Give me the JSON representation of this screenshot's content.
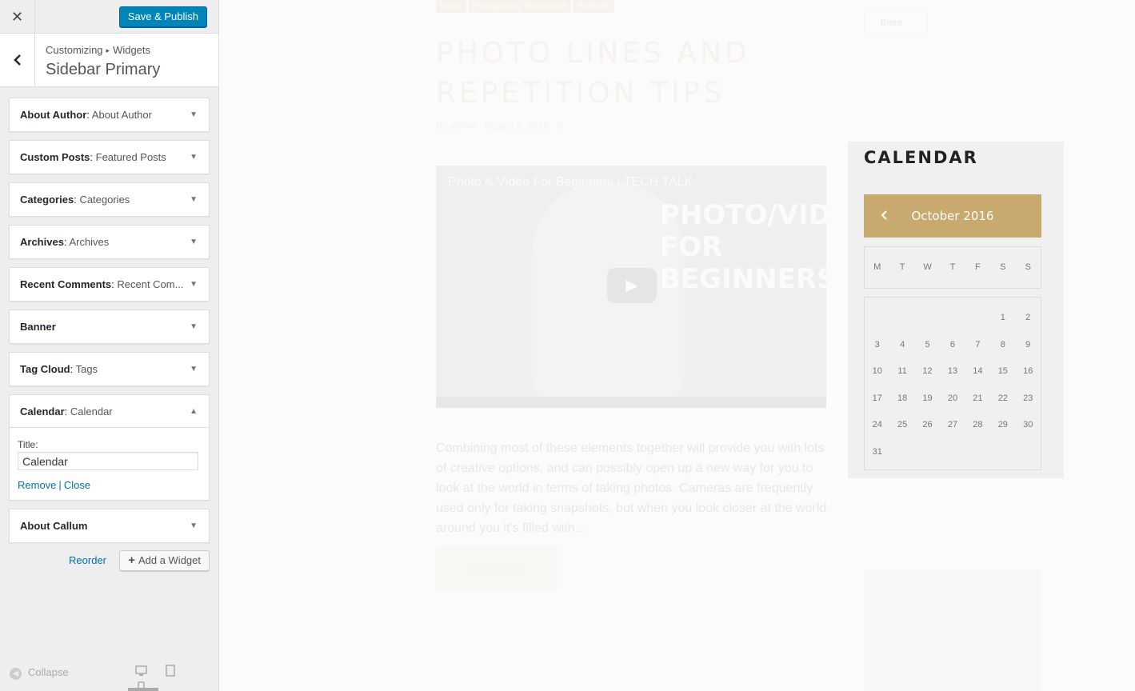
{
  "customizer": {
    "close_glyph": "✕",
    "publish_label": "Save & Publish",
    "breadcrumb_root": "Customizing",
    "breadcrumb_sep": "▸",
    "breadcrumb_leaf": "Widgets",
    "section_title": "Sidebar Primary",
    "widgets": [
      {
        "name": "About Author",
        "title": "About Author"
      },
      {
        "name": "Custom Posts",
        "title": "Featured Posts"
      },
      {
        "name": "Categories",
        "title": "Categories"
      },
      {
        "name": "Archives",
        "title": "Archives"
      },
      {
        "name": "Recent Comments",
        "title": "Recent Com..."
      },
      {
        "name": "Banner",
        "title": ""
      },
      {
        "name": "Tag Cloud",
        "title": "Tags"
      }
    ],
    "open_widget": {
      "name": "Calendar",
      "title": "Calendar",
      "field_label": "Title:",
      "field_value": "Calendar",
      "remove_label": "Remove",
      "close_label": "Close"
    },
    "last_widget": {
      "name": "About Callum",
      "title": ""
    },
    "reorder_label": "Reorder",
    "add_widget_label": "Add a Widget",
    "collapse_label": "Collapse"
  },
  "preview": {
    "tags": [
      "News",
      "Photography techniques",
      "Portraits"
    ],
    "post_title": "PHOTO LINES AND REPETITION TIPS",
    "post_meta": "By admin - August 9, 2016 - 0",
    "video_title": "Photo & Video For Beginners | TECH TALK",
    "video_overlay": "PHOTO/VIDEO FOR BEGINNERS",
    "excerpt": "Combining most of these elements together will provide you with lots of creative options, and can possibly open up a new way for you to look at the world in terms of taking photos. Cameras are frequently used only for taking snapshots, but when you look closer at the world around you it's filled with…",
    "read_more": "Read more",
    "search_text": "there",
    "calendar": {
      "heading": "CALENDAR",
      "month": "October 2016",
      "weekdays": [
        "M",
        "T",
        "W",
        "T",
        "F",
        "S",
        "S"
      ],
      "weeks": [
        [
          "",
          "",
          "",
          "",
          "",
          "1",
          "2"
        ],
        [
          "3",
          "4",
          "5",
          "6",
          "7",
          "8",
          "9"
        ],
        [
          "10",
          "11",
          "12",
          "13",
          "14",
          "15",
          "16"
        ],
        [
          "17",
          "18",
          "19",
          "20",
          "21",
          "22",
          "23"
        ],
        [
          "24",
          "25",
          "26",
          "27",
          "28",
          "29",
          "30"
        ],
        [
          "31",
          "",
          "",
          "",
          "",
          "",
          ""
        ]
      ]
    }
  },
  "colors": {
    "publish_blue": "#0085ba",
    "link_blue": "#0073aa",
    "gold_accent": "#c8a96e"
  }
}
